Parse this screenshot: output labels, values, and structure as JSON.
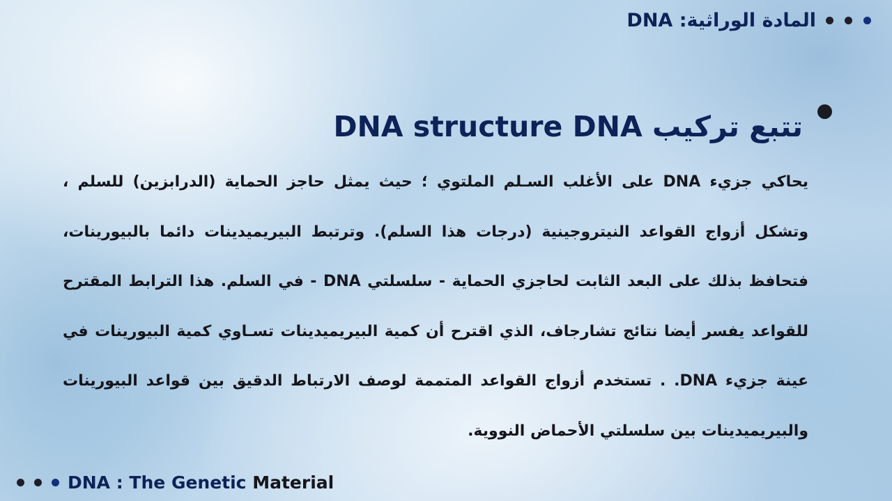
{
  "header": {
    "title": "المادة الوراثية: DNA"
  },
  "main": {
    "heading": "تتبع تركيب DNA structure DNA",
    "paragraph": "يحاكي جزيء DNA على الأغلب السـلم الملتوي ؛ حيث يمثل حاجز الحماية (الدرابزين) للسلم ، وتشكل أزواج القواعد النيتروجينية (درجات هذا السلم). وترتبط البيريميدينات دائما بالبيورينات، فتحافظ بذلك على البعد الثابت لحاجزي الحماية - سلسلتي DNA - في السلم. هذا الترابط المقترح للقواعد يفسر أيضا نتائج تشارجاف، الذي اقترح أن كمية البيريميدينات تسـاوي كمية البيورينات في عينة جزيء DNA. . تستخدم أزواج القواعد المتممة لوصف الارتباط الدقيق بين قواعد البيورينات والبيريميدينات بين سلسلتي الأحماض النووية."
  },
  "footer": {
    "text_main": "DNA : The Genetic ",
    "text_accent": "Material"
  },
  "colors": {
    "title": "#0d2257",
    "body": "#15151c",
    "dot_dark": "#1e1e28",
    "dot_navy": "#14307a"
  }
}
